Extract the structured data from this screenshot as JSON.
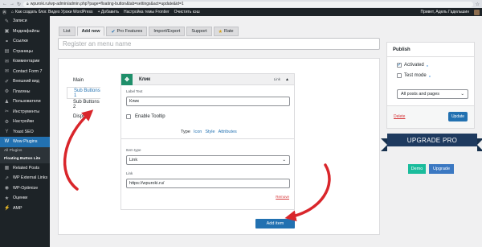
{
  "browser": {
    "url": "wpuroki.ru/wp-admin/admin.php?page=floating-button&tab=settings&act=update&id=1"
  },
  "adminbar": {
    "site": "Как создать блог. Видео Уроки WordPress",
    "add_new": "+ Добавить",
    "theme": "Настройка темы Frontier",
    "cache": "Очистить кэш",
    "greeting": "Привет, Адель Гадельшин"
  },
  "sidebar": {
    "items": [
      {
        "icon": "pin-icon",
        "glyph": "✎",
        "label": "Записи"
      },
      {
        "icon": "media-icon",
        "glyph": "▣",
        "label": "Медиафайлы"
      },
      {
        "icon": "link-icon",
        "glyph": "⚭",
        "label": "Ссылки"
      },
      {
        "icon": "pages-icon",
        "glyph": "▤",
        "label": "Страницы"
      },
      {
        "icon": "comments-icon",
        "glyph": "✉",
        "label": "Комментарии"
      },
      {
        "icon": "mail-icon",
        "glyph": "✉",
        "label": "Contact Form 7"
      },
      {
        "icon": "brush-icon",
        "glyph": "✐",
        "label": "Внешний вид"
      },
      {
        "icon": "plugins-icon",
        "glyph": "⚙",
        "label": "Плагины"
      },
      {
        "icon": "users-icon",
        "glyph": "♟",
        "label": "Пользователи"
      },
      {
        "icon": "tools-icon",
        "glyph": "✂",
        "label": "Инструменты"
      },
      {
        "icon": "settings-icon",
        "glyph": "⚙",
        "label": "Настройки"
      },
      {
        "icon": "yoast-icon",
        "glyph": "Y",
        "label": "Yoast SEO"
      },
      {
        "icon": "wow-icon",
        "glyph": "W",
        "label": "Wow Plugins"
      }
    ],
    "sub": [
      "All Plugins",
      "Floating Button Lite"
    ],
    "bottom": [
      {
        "icon": "related-icon",
        "glyph": "▦",
        "label": "Related Posts"
      },
      {
        "icon": "external-icon",
        "glyph": "⇗",
        "label": "WP External Links"
      },
      {
        "icon": "optimize-icon",
        "glyph": "◉",
        "label": "WP-Optimize"
      },
      {
        "icon": "rating-icon",
        "glyph": "★",
        "label": "Оценки"
      },
      {
        "icon": "amp-icon",
        "glyph": "⚡",
        "label": "AMP"
      }
    ]
  },
  "tabs": [
    "List",
    "Add new",
    "Pro Features",
    "Import/Export",
    "Support",
    "Rate"
  ],
  "menu_name": {
    "placeholder": "Register an menu name"
  },
  "leftnav": [
    "Main",
    "Sub Buttons 1",
    "Sub Buttons 2",
    "Display"
  ],
  "item": {
    "title": "Клик",
    "type": "Link",
    "label_text_label": "Label Text",
    "label_text_value": "Клик",
    "enable_tooltip": "Enable Tooltip",
    "subtabs": [
      "Type",
      "Icon",
      "Style",
      "Attributes"
    ],
    "item_type_label": "Item type",
    "item_type_value": "Link",
    "link_label": "Link",
    "link_value": "https://wpuroki.ru/",
    "remove": "Remove"
  },
  "add_item": "Add item",
  "publish": {
    "title": "Publish",
    "activated": "Activated",
    "test_mode": "Test mode",
    "select": "All posts and pages",
    "delete": "Delete",
    "update": "Update"
  },
  "upgrade": {
    "ribbon": "UPGRADE PRO",
    "demo": "Demo",
    "upgrade": "Upgrade"
  },
  "colors": {
    "accent": "#2271b1",
    "annotation": "#d9262b",
    "ribbon": "#1e3a5f"
  }
}
